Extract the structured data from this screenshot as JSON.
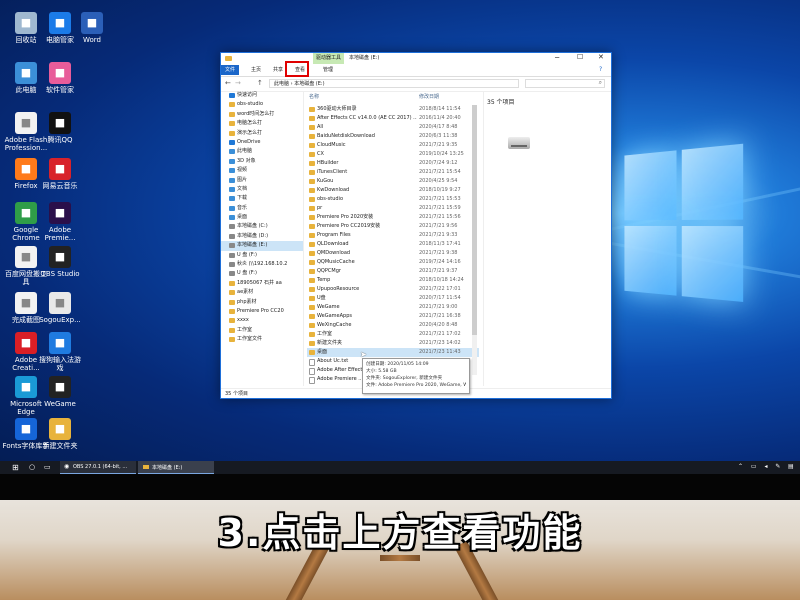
{
  "desktop": {
    "icons": [
      {
        "label": "回收站",
        "icon": "recycle-bin-icon",
        "color": "#9fb8d0"
      },
      {
        "label": "电脑管家",
        "icon": "shield-icon",
        "color": "#1b7be8"
      },
      {
        "label": "Word",
        "icon": "word-icon",
        "color": "#2b5fb8"
      },
      {
        "label": "此电脑",
        "icon": "computer-icon",
        "color": "#3b8fd8"
      },
      {
        "label": "软件管家",
        "icon": "app-store-icon",
        "color": "#e85c9a"
      },
      {
        "label": "Adobe Flash Profession...",
        "icon": "document-icon",
        "color": "#f2f2f2"
      },
      {
        "label": "腾讯QQ",
        "icon": "qq-icon",
        "color": "#111"
      },
      {
        "label": "Firefox",
        "icon": "firefox-icon",
        "color": "#ff7a1a"
      },
      {
        "label": "网易云音乐",
        "icon": "music-icon",
        "color": "#d8222a"
      },
      {
        "label": "Google Chrome",
        "icon": "chrome-icon",
        "color": "#2f9d48"
      },
      {
        "label": "Adobe Premie...",
        "icon": "premiere-icon",
        "color": "#2a0f4a"
      },
      {
        "label": "百度网盘搬工具",
        "icon": "document-icon",
        "color": "#f2f2f2"
      },
      {
        "label": "OBS Studio",
        "icon": "obs-icon",
        "color": "#222"
      },
      {
        "label": "完成截图",
        "icon": "document-icon",
        "color": "#f2f2f2"
      },
      {
        "label": "SogouExp...",
        "icon": "sogou-icon",
        "color": "#e9e9e9"
      },
      {
        "label": "Adobe Creati...",
        "icon": "creative-cloud-icon",
        "color": "#da1f26"
      },
      {
        "label": "搜狗输入法游戏",
        "icon": "sogou-input-icon",
        "color": "#1f7be0"
      },
      {
        "label": "Microsoft Edge",
        "icon": "edge-icon",
        "color": "#1a9ad6"
      },
      {
        "label": "WeGame",
        "icon": "wegame-icon",
        "color": "#222"
      },
      {
        "label": "Fonts字体库手",
        "icon": "fonts-icon",
        "color": "#1565d8"
      },
      {
        "label": "新建文件夹",
        "icon": "folder-icon",
        "color": "#e8b33c"
      }
    ]
  },
  "explorer": {
    "context_tab": "驱动器工具",
    "window_title": "本地磁盘 (E:)",
    "tabs": [
      "文件",
      "主页",
      "共享",
      "查看",
      "管理"
    ],
    "highlight_color": "#e00000",
    "path_items": [
      "此电脑",
      "本地磁盘 (E:)"
    ],
    "search_placeholder": "",
    "col_name": "名称",
    "col_date": "修改日期",
    "nav_items": [
      {
        "label": "快速访问",
        "color": "#1f78d6"
      },
      {
        "label": "obs-studio",
        "color": "#e8b33c"
      },
      {
        "label": "word时间怎么打",
        "color": "#e8b33c"
      },
      {
        "label": "电脑怎么打",
        "color": "#e8b33c"
      },
      {
        "label": "演示怎么打",
        "color": "#e8b33c"
      },
      {
        "label": "OneDrive",
        "color": "#1f78d6"
      },
      {
        "label": "此电脑",
        "color": "#3b8fd8"
      },
      {
        "label": "3D 对象",
        "color": "#3b8fd8"
      },
      {
        "label": "视频",
        "color": "#3b8fd8"
      },
      {
        "label": "图片",
        "color": "#3b8fd8"
      },
      {
        "label": "文档",
        "color": "#3b8fd8"
      },
      {
        "label": "下载",
        "color": "#3b8fd8"
      },
      {
        "label": "音乐",
        "color": "#3b8fd8"
      },
      {
        "label": "桌面",
        "color": "#3b8fd8"
      },
      {
        "label": "本地磁盘 (C:)",
        "color": "#888"
      },
      {
        "label": "本地磁盘 (D:)",
        "color": "#888"
      },
      {
        "label": "本地磁盘 (E:)",
        "color": "#888"
      },
      {
        "label": "U 盘 (F:)",
        "color": "#888"
      },
      {
        "label": "秋炎 (\\\\192.168.10.2",
        "color": "#888"
      },
      {
        "label": "U 盘 (F:)",
        "color": "#888"
      },
      {
        "label": "18905067 石井 aa",
        "color": "#e8b33c"
      },
      {
        "label": "ae素材",
        "color": "#e8b33c"
      },
      {
        "label": "php素材",
        "color": "#e8b33c"
      },
      {
        "label": "Premiere Pro CC20",
        "color": "#e8b33c"
      },
      {
        "label": "xxxx",
        "color": "#e8b33c"
      },
      {
        "label": "工作室",
        "color": "#e8b33c"
      },
      {
        "label": "工作室文件",
        "color": "#e8b33c"
      }
    ],
    "files": [
      {
        "name": "360驱动大师目录",
        "date": "2018/8/14 11:54"
      },
      {
        "name": "After Effects CC v14.0.0 (AE CC 2017) ...",
        "date": "2016/11/4 20:40"
      },
      {
        "name": "All",
        "date": "2020/4/17 8:48"
      },
      {
        "name": "BaiduNetdiskDownload",
        "date": "2020/6/3 11:38"
      },
      {
        "name": "CloudMusic",
        "date": "2021/7/21 9:35"
      },
      {
        "name": "CX",
        "date": "2019/10/24 13:25"
      },
      {
        "name": "HBuilder",
        "date": "2020/7/24 9:12"
      },
      {
        "name": "iTunesClient",
        "date": "2021/7/21 15:54"
      },
      {
        "name": "KuGou",
        "date": "2020/4/25 9:54"
      },
      {
        "name": "KwDownload",
        "date": "2018/10/19 9:27"
      },
      {
        "name": "obs-studio",
        "date": "2021/7/21 15:53"
      },
      {
        "name": "pr",
        "date": "2021/7/21 15:59"
      },
      {
        "name": "Premiere Pro 2020安装",
        "date": "2021/7/21 15:56"
      },
      {
        "name": "Premiere Pro CC2019安装",
        "date": "2021/7/21 9:56"
      },
      {
        "name": "Program Files",
        "date": "2021/7/21 9:33"
      },
      {
        "name": "QLDownload",
        "date": "2018/11/3 17:41"
      },
      {
        "name": "QMDownload",
        "date": "2021/7/21 9:38"
      },
      {
        "name": "QQMusicCache",
        "date": "2019/7/24 14:16"
      },
      {
        "name": "QQPCMgr",
        "date": "2021/7/21 9:37"
      },
      {
        "name": "Temp",
        "date": "2018/10/18 14:24"
      },
      {
        "name": "UpupooResource",
        "date": "2021/7/22 17:01"
      },
      {
        "name": "U盘",
        "date": "2020/7/17 11:54"
      },
      {
        "name": "WeGame",
        "date": "2021/7/21 9:00"
      },
      {
        "name": "WeGameApps",
        "date": "2021/7/21 16:38"
      },
      {
        "name": "WeXingCache",
        "date": "2020/4/20 8:48"
      },
      {
        "name": "工作室",
        "date": "2021/7/21 17:02"
      },
      {
        "name": "新建文件夹",
        "date": "2021/7/23 14:02"
      },
      {
        "name": "桌面",
        "date": "2021/7/23 11:43"
      },
      {
        "name": "About Uc.txt",
        "date": ""
      },
      {
        "name": "Adobe After Effects ...",
        "date": ""
      },
      {
        "name": "Adobe Premiere ...",
        "date": ""
      }
    ],
    "preview_count": "35 个项目",
    "status": "35 个项目",
    "tooltip": [
      "创建日期: 2020/11/05 14:09",
      "大小: 5.58 GB",
      "文件夹: SogouExplorer, 新建文件夹",
      "文件: Adobe Premiere Pro 2020, WeGame, Word, 移动用户设置数"
    ]
  },
  "taskbar": {
    "items": [
      "OBS 27.0.1 (64-bit, ...",
      "本地磁盘 (E:)"
    ],
    "color": "#161a22"
  },
  "caption": "3.点击上方查看功能"
}
